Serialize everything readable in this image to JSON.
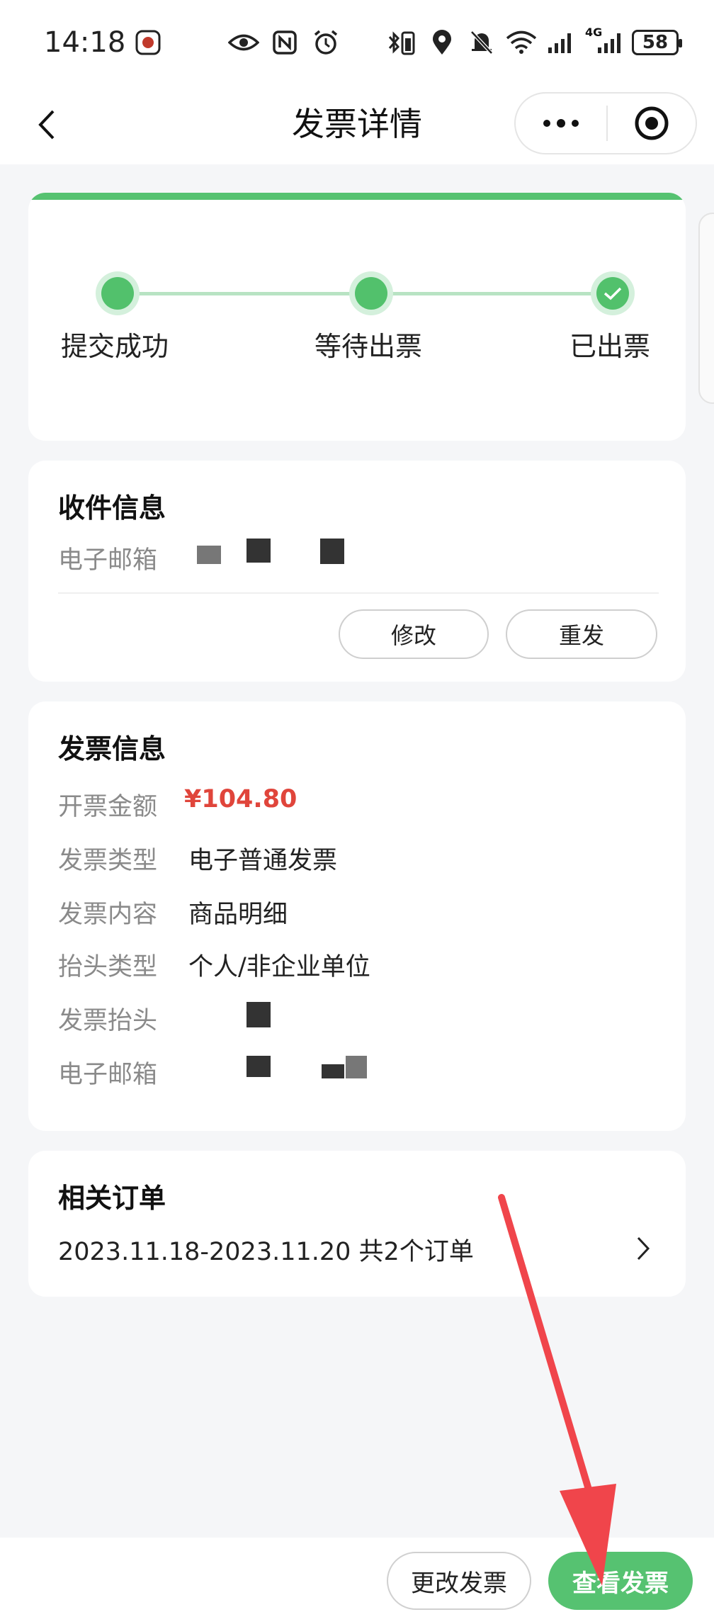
{
  "status_bar": {
    "time": "14:18",
    "network_label": "4G",
    "battery": "58"
  },
  "nav": {
    "title": "发票详情"
  },
  "progress": {
    "steps": [
      {
        "label": "提交成功",
        "state": "done"
      },
      {
        "label": "等待出票",
        "state": "done"
      },
      {
        "label": "已出票",
        "state": "checked"
      }
    ],
    "accent": "#56c271"
  },
  "receiver": {
    "title": "收件信息",
    "email_label": "电子邮箱",
    "edit_label": "修改",
    "resend_label": "重发"
  },
  "invoice": {
    "title": "发票信息",
    "rows": [
      {
        "label": "开票金额",
        "value": "¥104.80"
      },
      {
        "label": "发票类型",
        "value": "电子普通发票"
      },
      {
        "label": "发票内容",
        "value": "商品明细"
      },
      {
        "label": "抬头类型",
        "value": "个人/非企业单位"
      },
      {
        "label": "发票抬头",
        "value": ""
      },
      {
        "label": "电子邮箱",
        "value": ""
      }
    ],
    "amount_color": "#e0453b"
  },
  "orders": {
    "title": "相关订单",
    "summary": "2023.11.18-2023.11.20 共2个订单"
  },
  "bottom": {
    "change_label": "更改发票",
    "view_label": "查看发票"
  }
}
